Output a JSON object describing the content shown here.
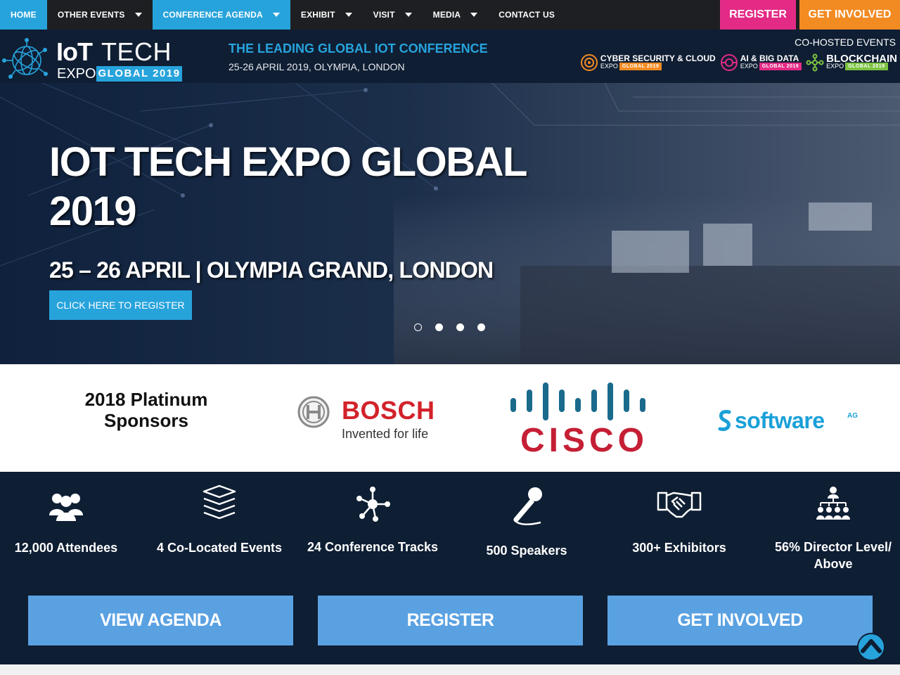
{
  "nav": {
    "items": [
      {
        "label": "HOME",
        "has_caret": false,
        "active": true
      },
      {
        "label": "OTHER EVENTS",
        "has_caret": true,
        "active": false
      },
      {
        "label": "CONFERENCE AGENDA",
        "has_caret": true,
        "active": true
      },
      {
        "label": "EXHIBIT",
        "has_caret": true,
        "active": false
      },
      {
        "label": "VISIT",
        "has_caret": true,
        "active": false
      },
      {
        "label": "MEDIA",
        "has_caret": true,
        "active": false
      },
      {
        "label": "CONTACT US",
        "has_caret": false,
        "active": false
      }
    ],
    "register": "REGISTER",
    "get_involved": "GET INVOLVED"
  },
  "header": {
    "logo": {
      "iot": "IoT",
      "tech": "TECH",
      "expo": "EXPO",
      "global": "GLOBAL 2019"
    },
    "tagline": "THE LEADING GLOBAL IOT CONFERENCE",
    "dates": "25-26 APRIL 2019, OLYMPIA, LONDON",
    "cohosted_label": "CO-HOSTED EVENTS",
    "cohosted": [
      {
        "name": "CYBER SECURITY & CLOUD",
        "expo": "EXPO",
        "edition": "GLOBAL 2019",
        "color": "#f28b22"
      },
      {
        "name": "AI & BIG DATA",
        "expo": "EXPO",
        "edition": "GLOBAL 2019",
        "color": "#e32b86"
      },
      {
        "name": "BLOCKCHAIN",
        "expo": "EXPO",
        "edition": "GLOBAL 2019",
        "color": "#7cc242"
      }
    ]
  },
  "hero": {
    "title": "IOT TECH EXPO GLOBAL 2019",
    "subtitle": "25 – 26 APRIL | OLYMPIA GRAND, LONDON",
    "cta": "CLICK HERE TO REGISTER",
    "slide_count": 4,
    "active_slide": 0
  },
  "sponsors": {
    "label": "2018 Platinum Sponsors",
    "bosch": {
      "name": "BOSCH",
      "tagline": "Invented for life"
    },
    "cisco": {
      "name": "CISCO"
    },
    "software_ag": {
      "name": "software",
      "suffix": "AG"
    }
  },
  "stats": [
    {
      "label": "12,000 Attendees",
      "icon": "attendees-icon"
    },
    {
      "label": "4 Co-Located Events",
      "icon": "layers-icon"
    },
    {
      "label": "24 Conference Tracks",
      "icon": "network-icon"
    },
    {
      "label": "500 Speakers",
      "icon": "microphone-icon"
    },
    {
      "label": "300+ Exhibitors",
      "icon": "handshake-icon"
    },
    {
      "label": "56% Director Level/ Above",
      "icon": "org-chart-icon"
    }
  ],
  "buttons": {
    "view_agenda": "VIEW AGENDA",
    "register": "REGISTER",
    "get_involved": "GET INVOLVED"
  },
  "colors": {
    "accent_blue": "#27a3dc",
    "navy": "#0e1e33",
    "pink": "#e32b86",
    "orange": "#f28b22",
    "button_blue": "#5aa1e2"
  }
}
